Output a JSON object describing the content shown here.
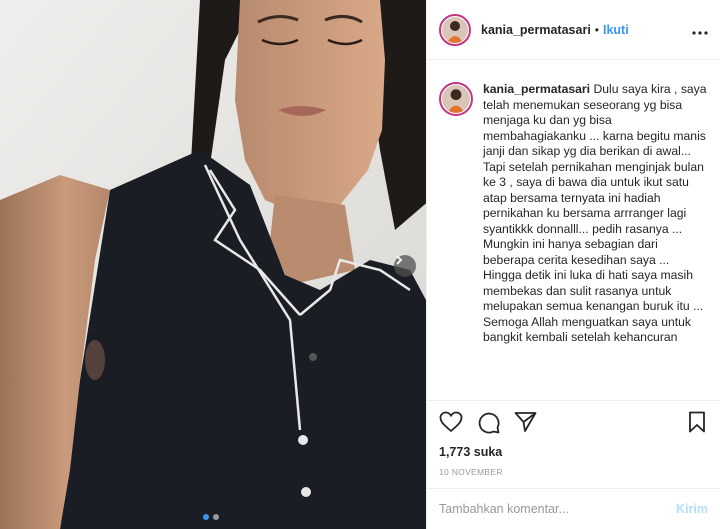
{
  "post": {
    "username": "kania_permatasari",
    "separator": "•",
    "follow_label": "Ikuti",
    "more_icon": "more-horizontal-icon",
    "caption_lines": [
      "Dulu saya kira , saya telah menemukan seseorang yg bisa menjaga ku dan yg bisa membahagiakanku ... karna begitu manis janji dan sikap yg dia berikan di awal...",
      "Tapi setelah pernikahan menginjak bulan ke 3 , saya di bawa dia untuk ikut satu atap bersama ternyata ini hadiah pernikahan ku bersama arrranger lagi syantikkk donnalll... pedih rasanya ...",
      "Mungkin ini hanya sebagian dari beberapa cerita kesedihan saya ...",
      "Hingga detik ini luka di hati saya masih membekas dan sulit rasanya untuk melupakan semua kenangan buruk itu ...",
      "Semoga Allah menguatkan saya untuk bangkit kembali setelah kehancuran"
    ],
    "likes": "1,773 suka",
    "date": "10 NOVEMBER"
  },
  "carousel": {
    "slides_count": 2,
    "active_index": 0,
    "next_icon": "chevron-right-icon"
  },
  "actions": {
    "like_icon": "heart-icon",
    "comment_icon": "comment-icon",
    "share_icon": "share-icon",
    "save_icon": "bookmark-icon"
  },
  "comment_box": {
    "placeholder": "Tambahkan komentar...",
    "post_label": "Kirim"
  },
  "colors": {
    "link_blue": "#3897f0",
    "post_disabled": "#b2dffc",
    "story_ring": "#c13584"
  }
}
